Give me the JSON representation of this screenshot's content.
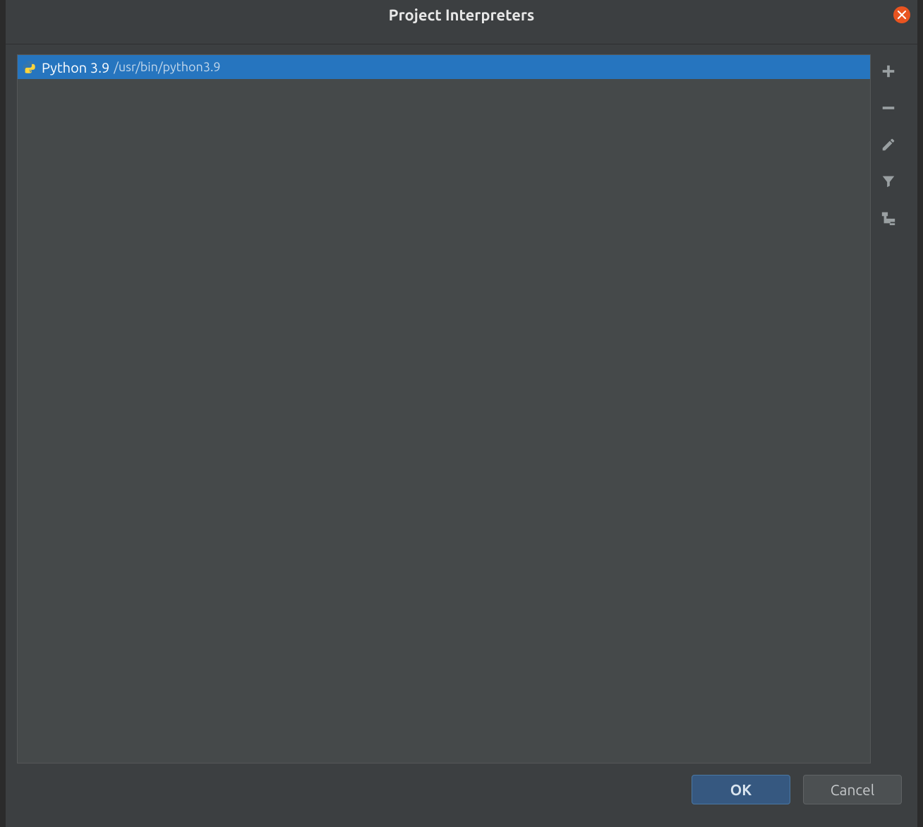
{
  "dialog": {
    "title": "Project Interpreters"
  },
  "interpreters": [
    {
      "icon": "python-icon",
      "name": "Python 3.9",
      "path": "/usr/bin/python3.9",
      "selected": true
    }
  ],
  "toolbar": {
    "add": "plus-icon",
    "remove": "minus-icon",
    "edit": "pencil-icon",
    "filter": "filter-icon",
    "tree": "tree-icon"
  },
  "footer": {
    "ok_label": "OK",
    "cancel_label": "Cancel"
  }
}
